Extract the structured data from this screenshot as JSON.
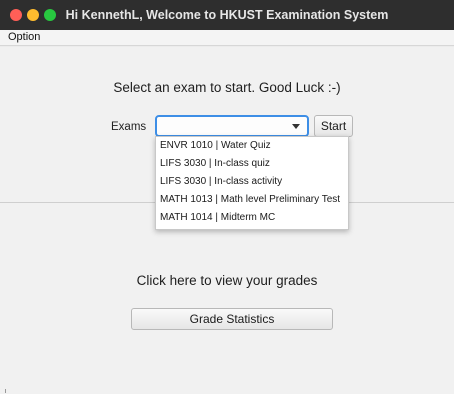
{
  "window": {
    "title": "Hi KennethL, Welcome to HKUST Examination System",
    "traffic_lights": {
      "close": "#ff5f57",
      "minimize": "#febc2e",
      "maximize": "#28c840"
    }
  },
  "menu": {
    "items": [
      {
        "label": "Option"
      }
    ]
  },
  "exam_section": {
    "headline": "Select an exam to start. Good Luck :-)",
    "exams_label": "Exams",
    "selected_value": "",
    "start_label": "Start",
    "options": [
      "ENVR 1010 | Water Quiz",
      "LIFS 3030 | In-class quiz",
      "LIFS 3030 | In-class activity",
      "MATH 1013 | Math level Preliminary Test",
      "MATH 1014 | Midterm MC"
    ]
  },
  "grades_section": {
    "prompt": "Click here to view your grades",
    "button_label": "Grade Statistics"
  },
  "colors": {
    "accent": "#3d8ee6",
    "titlebar": "#2e2e2e"
  }
}
